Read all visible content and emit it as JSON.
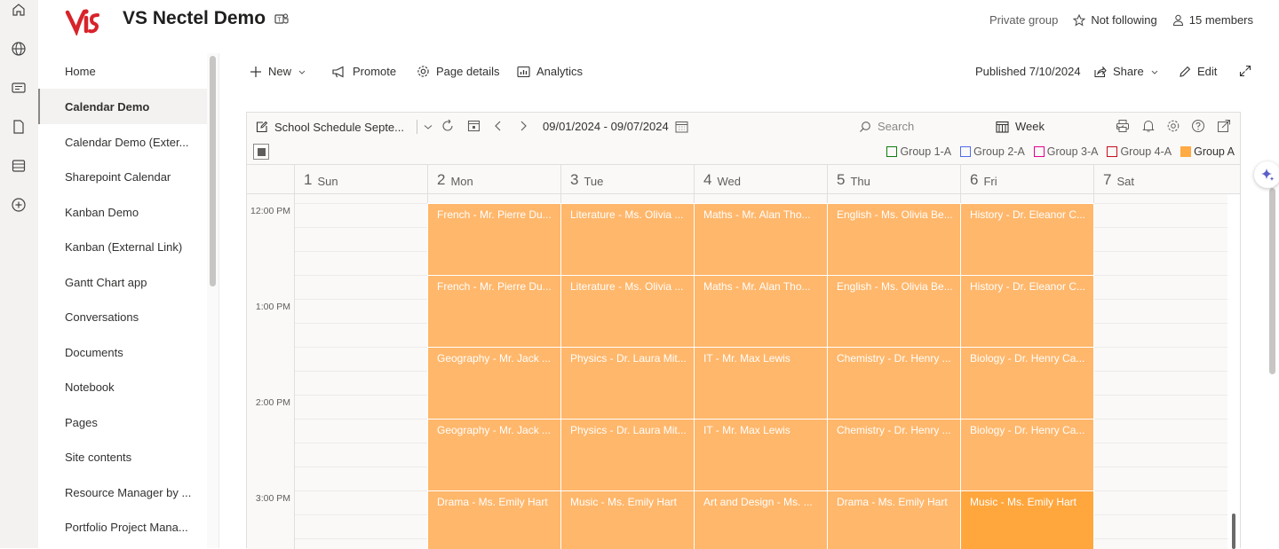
{
  "site": {
    "title": "VS Nectel Demo",
    "privacy": "Private group",
    "follow": "Not following",
    "members": "15 members"
  },
  "nav": [
    {
      "label": "Home",
      "active": false
    },
    {
      "label": "Calendar Demo",
      "active": true
    },
    {
      "label": "Calendar Demo (Exter...",
      "active": false
    },
    {
      "label": "Sharepoint Calendar",
      "active": false
    },
    {
      "label": "Kanban Demo",
      "active": false
    },
    {
      "label": "Kanban (External Link)",
      "active": false
    },
    {
      "label": "Gantt Chart app",
      "active": false
    },
    {
      "label": "Conversations",
      "active": false
    },
    {
      "label": "Documents",
      "active": false
    },
    {
      "label": "Notebook",
      "active": false
    },
    {
      "label": "Pages",
      "active": false
    },
    {
      "label": "Site contents",
      "active": false
    },
    {
      "label": "Resource Manager by ...",
      "active": false
    },
    {
      "label": "Portfolio Project Mana...",
      "active": false
    }
  ],
  "cmdbar": {
    "new": "New",
    "promote": "Promote",
    "page_details": "Page details",
    "analytics": "Analytics",
    "published": "Published 7/10/2024",
    "share": "Share",
    "edit": "Edit"
  },
  "calendar": {
    "name": "School Schedule Septe...",
    "date_range": "09/01/2024 - 09/07/2024",
    "search_placeholder": "Search",
    "view": "Week",
    "legend": [
      {
        "label": "Group 1-A",
        "color": "#107c10",
        "filled": false
      },
      {
        "label": "Group 2-A",
        "color": "#4f6bed",
        "filled": false
      },
      {
        "label": "Group 3-A",
        "color": "#e3008c",
        "filled": false
      },
      {
        "label": "Group 4-A",
        "color": "#c50f1f",
        "filled": false
      },
      {
        "label": "Group A",
        "color": "#ffaa44",
        "filled": true
      }
    ],
    "days": [
      {
        "num": "1",
        "name": "Sun"
      },
      {
        "num": "2",
        "name": "Mon"
      },
      {
        "num": "3",
        "name": "Tue"
      },
      {
        "num": "4",
        "name": "Wed"
      },
      {
        "num": "5",
        "name": "Thu"
      },
      {
        "num": "6",
        "name": "Fri"
      },
      {
        "num": "7",
        "name": "Sat"
      }
    ],
    "times": [
      "12:00 PM",
      "1:00 PM",
      "2:00 PM",
      "3:00 PM"
    ],
    "event_rows": [
      [
        "French - Mr. Pierre Du...",
        "Literature - Ms. Olivia ...",
        "Maths - Mr. Alan Tho...",
        "English - Ms. Olivia Be...",
        "History - Dr. Eleanor C..."
      ],
      [
        "French - Mr. Pierre Du...",
        "Literature - Ms. Olivia ...",
        "Maths - Mr. Alan Tho...",
        "English - Ms. Olivia Be...",
        "History - Dr. Eleanor C..."
      ],
      [
        "Geography - Mr. Jack ...",
        "Physics - Dr. Laura Mit...",
        "IT - Mr. Max Lewis",
        "Chemistry - Dr. Henry ...",
        "Biology - Dr. Henry Ca..."
      ],
      [
        "Geography - Mr. Jack ...",
        "Physics - Dr. Laura Mit...",
        "IT - Mr. Max Lewis",
        "Chemistry - Dr. Henry ...",
        "Biology - Dr. Henry Ca..."
      ],
      [
        "Drama - Ms. Emily Hart",
        "Music - Ms. Emily Hart",
        "Art and Design - Ms. ...",
        "Drama - Ms. Emily Hart",
        "Music - Ms. Emily Hart"
      ]
    ]
  }
}
